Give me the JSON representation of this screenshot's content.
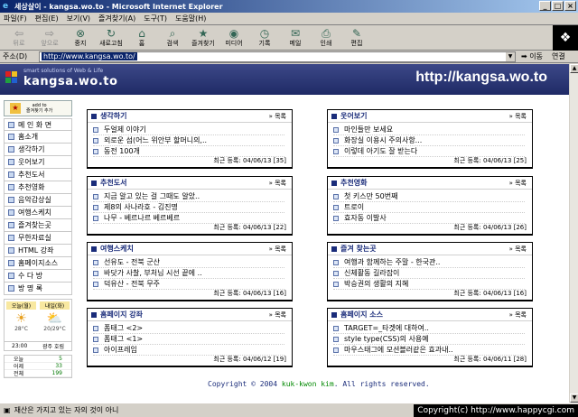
{
  "window": {
    "title": "세상살이 - kangsa.wo.to - Microsoft Internet Explorer"
  },
  "menu": [
    "파일(F)",
    "편집(E)",
    "보기(V)",
    "즐겨찾기(A)",
    "도구(T)",
    "도움말(H)"
  ],
  "toolbar": [
    {
      "label": "뒤로",
      "icon": "back-arrow-icon",
      "glyph": "⇦",
      "disabled": true
    },
    {
      "label": "앞으로",
      "icon": "forward-arrow-icon",
      "glyph": "⇨",
      "disabled": true
    },
    {
      "label": "중지",
      "icon": "stop-icon",
      "glyph": "⊗",
      "disabled": false
    },
    {
      "label": "새로고침",
      "icon": "refresh-icon",
      "glyph": "↻",
      "disabled": false
    },
    {
      "label": "홈",
      "icon": "home-icon",
      "glyph": "⌂",
      "disabled": false
    },
    {
      "label": "검색",
      "icon": "search-icon",
      "glyph": "⌕",
      "disabled": false
    },
    {
      "label": "즐겨찾기",
      "icon": "favorites-icon",
      "glyph": "★",
      "disabled": false
    },
    {
      "label": "미디어",
      "icon": "media-icon",
      "glyph": "◉",
      "disabled": false
    },
    {
      "label": "기록",
      "icon": "history-icon",
      "glyph": "◷",
      "disabled": false
    },
    {
      "label": "메일",
      "icon": "mail-icon",
      "glyph": "✉",
      "disabled": false
    },
    {
      "label": "인쇄",
      "icon": "print-icon",
      "glyph": "⎙",
      "disabled": false
    },
    {
      "label": "편집",
      "icon": "edit-icon",
      "glyph": "✎",
      "disabled": false
    }
  ],
  "address": {
    "label": "주소(D)",
    "value": "http://www.kangsa.wo.to/",
    "go": "이동",
    "links": "연결"
  },
  "header": {
    "tagline": "smart solutions of Web & Life",
    "site": "kangsa.wo.to",
    "url": "http://kangsa.wo.to"
  },
  "sidebar": {
    "addfav_top": "add to",
    "addfav_bottom": "즐겨찾기 추가",
    "items": [
      "메 인 화 면",
      "홈소개",
      "생각하기",
      "웃어보기",
      "추천도서",
      "추천영화",
      "음악감상실",
      "여행스케치",
      "즐겨찾는곳",
      "무한자료실",
      "HTML 강좌",
      "홈페이지소스",
      "수 다 방",
      "방 명 록"
    ]
  },
  "weather": {
    "today": "오늘(월)",
    "tomorrow": "내일(화)",
    "today_temp": "28°C",
    "tomorrow_temp": "20/29°C",
    "time": "23:00",
    "region": "광주 호림"
  },
  "counter": [
    {
      "label": "오늘",
      "value": "5"
    },
    {
      "label": "어제",
      "value": "33"
    },
    {
      "label": "전체",
      "value": "199"
    }
  ],
  "boxes": [
    {
      "title": "생각하기",
      "more": "» 목록",
      "items": [
        "두얼제 이야기",
        "외로운 섬(어느 위안부 할머니의,..",
        "동전 100개"
      ],
      "footer": "최근 등록: 04/06/13 [35]"
    },
    {
      "title": "웃어보기",
      "more": "» 목록",
      "items": [
        "마인들만 보세요",
        "화장실 이용시 주의사항...",
        "이렇데 아기도 잘 받는다"
      ],
      "footer": "최근 등록: 04/06/13 [25]"
    },
    {
      "title": "추천도서",
      "more": "» 목록",
      "items": [
        "지금 알고 있는 걸 그때도 알았..",
        "제8의 사나라호 - 김진명",
        "나무 - 베르나르 베르베르"
      ],
      "footer": "최근 등록: 04/06/13 [22]"
    },
    {
      "title": "추천영화",
      "more": "» 목록",
      "items": [
        "첫 키스만 50번째",
        "트로이",
        "효자동 이발사"
      ],
      "footer": "최근 등록: 04/06/13 [26]"
    },
    {
      "title": "여행스케치",
      "more": "» 목록",
      "items": [
        "선유도 - 전북 군산",
        "바닷가 사찰, 부처님 시선 끝에 ..",
        "덕유산 - 전북 무주"
      ],
      "footer": "최근 등록: 04/06/13 [16]"
    },
    {
      "title": "즐겨 찾는곳",
      "more": "» 목록",
      "items": [
        "여행과 함께하는 주말 - 한국관..",
        "신체활동 길라잡이",
        "박승권의 생활의 지혜"
      ],
      "footer": "최근 등록: 04/06/13 [16]"
    },
    {
      "title": "홈페이지 강좌",
      "more": "» 목록",
      "items": [
        "폼태그 <2>",
        "폼태그 <1>",
        "아이프레임"
      ],
      "footer": "최근 등록: 04/06/12 [19]"
    },
    {
      "title": "홈페이지 소스",
      "more": "» 목록",
      "items": [
        "TARGET=_타겟에 대하여..",
        "style type(CSS)의 사용예",
        "마우스태그에 모션블러같은 효과내.."
      ],
      "footer": "최근 등록: 04/06/11 [28]"
    }
  ],
  "copyright": {
    "pre": "Copyright © 2004 ",
    "name": "kuk-kwon kim",
    "post": ". All rights reserved."
  },
  "status": {
    "text": "재산은 가지고 있는 자의 것이 아니",
    "watermark": "Copyright(c) http://www.happycgi.com"
  }
}
